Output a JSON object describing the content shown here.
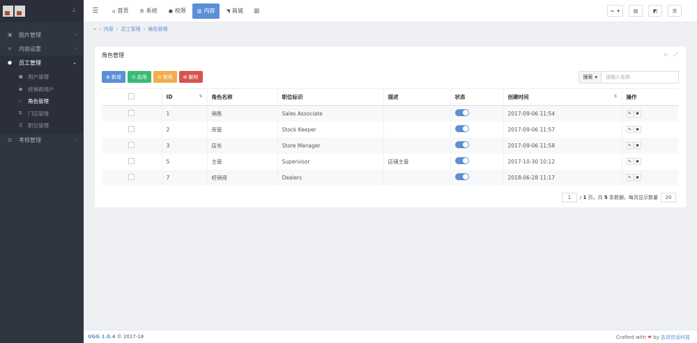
{
  "sidebar": {
    "toggle_icon": "droplet-icon",
    "menu": [
      {
        "label": "图片管理",
        "icon": "image-icon"
      },
      {
        "label": "内容设置",
        "icon": "sliders-icon"
      },
      {
        "label": "员工管理",
        "icon": "user-icon",
        "active": true,
        "children": [
          {
            "label": "用户管理",
            "icon": "lock-icon"
          },
          {
            "label": "经销商用户",
            "icon": "user-icon"
          },
          {
            "label": "角色管理",
            "icon": "share-icon",
            "current": true
          },
          {
            "label": "门店管理",
            "icon": "copy-icon"
          },
          {
            "label": "职位管理",
            "icon": "list-icon"
          }
        ]
      },
      {
        "label": "考核管理",
        "icon": "list-icon"
      }
    ]
  },
  "topbar": {
    "tabs": [
      {
        "label": "首页",
        "icon": "home-icon"
      },
      {
        "label": "系统",
        "icon": "gear-icon"
      },
      {
        "label": "权限",
        "icon": "user-icon"
      },
      {
        "label": "内容",
        "icon": "columns-icon",
        "active": true
      },
      {
        "label": "商城",
        "icon": "cart-icon"
      }
    ]
  },
  "breadcrumb": {
    "items": [
      "内容",
      "员工管理",
      "角色管理"
    ]
  },
  "panel": {
    "title": "角色管理",
    "buttons": {
      "add": "新增",
      "enable": "启用",
      "disable": "禁用",
      "delete": "删除"
    },
    "search": {
      "dropdown": "搜索",
      "placeholder": "请输入名称"
    }
  },
  "table": {
    "headers": {
      "id": "ID",
      "name": "角色名称",
      "position": "职位标识",
      "desc": "描述",
      "status": "状态",
      "created": "创建时间",
      "ops": "操作"
    },
    "rows": [
      {
        "id": "1",
        "name": "销售",
        "position": "Sales Associate",
        "desc": "",
        "created": "2017-09-06 11:54"
      },
      {
        "id": "2",
        "name": "库管",
        "position": "Stock Keeper",
        "desc": "",
        "created": "2017-09-06 11:57"
      },
      {
        "id": "3",
        "name": "店长",
        "position": "Store Manager",
        "desc": "",
        "created": "2017-09-06 11:58"
      },
      {
        "id": "5",
        "name": "主管",
        "position": "Supervisor",
        "desc": "店铺主管",
        "created": "2017-10-30 10:12"
      },
      {
        "id": "7",
        "name": "经销商",
        "position": "Dealers",
        "desc": "",
        "created": "2018-06-28 11:17"
      }
    ]
  },
  "pager": {
    "page": "1",
    "total_pages": "1",
    "total_rows": "5",
    "text_a": "/",
    "text_b": "页，共",
    "text_c": "条数据，每页显示数量",
    "page_size": "20"
  },
  "footer": {
    "version": "UGG 1.0.4",
    "copyright": "© 2017-18",
    "crafted": "Crafted with",
    "by": "by",
    "company": "志进信息科技"
  },
  "colors": {
    "sidebar": "#2f3541",
    "accent": "#5b8fd6",
    "green": "#3cba74",
    "orange": "#f0ad4e",
    "red": "#d9534f"
  }
}
